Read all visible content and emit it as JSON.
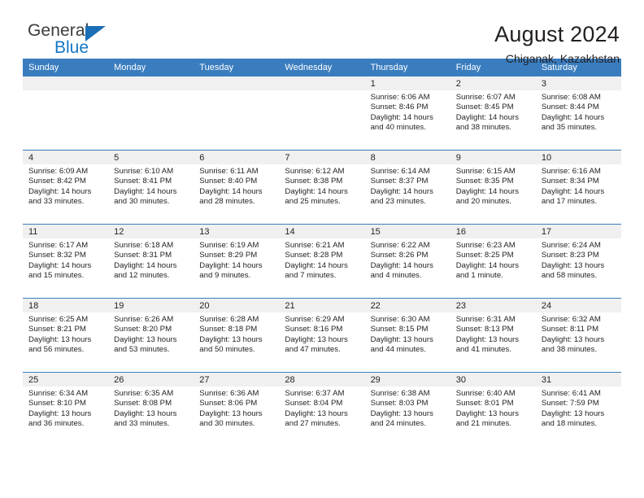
{
  "logo": {
    "word_one": "General",
    "word_two": "Blue",
    "triangle_color": "#1a6fb5"
  },
  "header": {
    "title": "August 2024",
    "subtitle": "Chiganak, Kazakhstan"
  },
  "theme": {
    "header_blue": "#3a7dbf",
    "daynum_gray": "#f0f0f0",
    "text": "#231f20"
  },
  "calendar": {
    "weekday_headers": [
      "Sunday",
      "Monday",
      "Tuesday",
      "Wednesday",
      "Thursday",
      "Friday",
      "Saturday"
    ],
    "labels": {
      "sunrise": "Sunrise:",
      "sunset": "Sunset:",
      "daylight": "Daylight:"
    },
    "weeks": [
      [
        {
          "day": ""
        },
        {
          "day": ""
        },
        {
          "day": ""
        },
        {
          "day": ""
        },
        {
          "day": "1",
          "sunrise": "Sunrise: 6:06 AM",
          "sunset": "Sunset: 8:46 PM",
          "daylight_1": "Daylight: 14 hours",
          "daylight_2": "and 40 minutes."
        },
        {
          "day": "2",
          "sunrise": "Sunrise: 6:07 AM",
          "sunset": "Sunset: 8:45 PM",
          "daylight_1": "Daylight: 14 hours",
          "daylight_2": "and 38 minutes."
        },
        {
          "day": "3",
          "sunrise": "Sunrise: 6:08 AM",
          "sunset": "Sunset: 8:44 PM",
          "daylight_1": "Daylight: 14 hours",
          "daylight_2": "and 35 minutes."
        }
      ],
      [
        {
          "day": "4",
          "sunrise": "Sunrise: 6:09 AM",
          "sunset": "Sunset: 8:42 PM",
          "daylight_1": "Daylight: 14 hours",
          "daylight_2": "and 33 minutes."
        },
        {
          "day": "5",
          "sunrise": "Sunrise: 6:10 AM",
          "sunset": "Sunset: 8:41 PM",
          "daylight_1": "Daylight: 14 hours",
          "daylight_2": "and 30 minutes."
        },
        {
          "day": "6",
          "sunrise": "Sunrise: 6:11 AM",
          "sunset": "Sunset: 8:40 PM",
          "daylight_1": "Daylight: 14 hours",
          "daylight_2": "and 28 minutes."
        },
        {
          "day": "7",
          "sunrise": "Sunrise: 6:12 AM",
          "sunset": "Sunset: 8:38 PM",
          "daylight_1": "Daylight: 14 hours",
          "daylight_2": "and 25 minutes."
        },
        {
          "day": "8",
          "sunrise": "Sunrise: 6:14 AM",
          "sunset": "Sunset: 8:37 PM",
          "daylight_1": "Daylight: 14 hours",
          "daylight_2": "and 23 minutes."
        },
        {
          "day": "9",
          "sunrise": "Sunrise: 6:15 AM",
          "sunset": "Sunset: 8:35 PM",
          "daylight_1": "Daylight: 14 hours",
          "daylight_2": "and 20 minutes."
        },
        {
          "day": "10",
          "sunrise": "Sunrise: 6:16 AM",
          "sunset": "Sunset: 8:34 PM",
          "daylight_1": "Daylight: 14 hours",
          "daylight_2": "and 17 minutes."
        }
      ],
      [
        {
          "day": "11",
          "sunrise": "Sunrise: 6:17 AM",
          "sunset": "Sunset: 8:32 PM",
          "daylight_1": "Daylight: 14 hours",
          "daylight_2": "and 15 minutes."
        },
        {
          "day": "12",
          "sunrise": "Sunrise: 6:18 AM",
          "sunset": "Sunset: 8:31 PM",
          "daylight_1": "Daylight: 14 hours",
          "daylight_2": "and 12 minutes."
        },
        {
          "day": "13",
          "sunrise": "Sunrise: 6:19 AM",
          "sunset": "Sunset: 8:29 PM",
          "daylight_1": "Daylight: 14 hours",
          "daylight_2": "and 9 minutes."
        },
        {
          "day": "14",
          "sunrise": "Sunrise: 6:21 AM",
          "sunset": "Sunset: 8:28 PM",
          "daylight_1": "Daylight: 14 hours",
          "daylight_2": "and 7 minutes."
        },
        {
          "day": "15",
          "sunrise": "Sunrise: 6:22 AM",
          "sunset": "Sunset: 8:26 PM",
          "daylight_1": "Daylight: 14 hours",
          "daylight_2": "and 4 minutes."
        },
        {
          "day": "16",
          "sunrise": "Sunrise: 6:23 AM",
          "sunset": "Sunset: 8:25 PM",
          "daylight_1": "Daylight: 14 hours",
          "daylight_2": "and 1 minute."
        },
        {
          "day": "17",
          "sunrise": "Sunrise: 6:24 AM",
          "sunset": "Sunset: 8:23 PM",
          "daylight_1": "Daylight: 13 hours",
          "daylight_2": "and 58 minutes."
        }
      ],
      [
        {
          "day": "18",
          "sunrise": "Sunrise: 6:25 AM",
          "sunset": "Sunset: 8:21 PM",
          "daylight_1": "Daylight: 13 hours",
          "daylight_2": "and 56 minutes."
        },
        {
          "day": "19",
          "sunrise": "Sunrise: 6:26 AM",
          "sunset": "Sunset: 8:20 PM",
          "daylight_1": "Daylight: 13 hours",
          "daylight_2": "and 53 minutes."
        },
        {
          "day": "20",
          "sunrise": "Sunrise: 6:28 AM",
          "sunset": "Sunset: 8:18 PM",
          "daylight_1": "Daylight: 13 hours",
          "daylight_2": "and 50 minutes."
        },
        {
          "day": "21",
          "sunrise": "Sunrise: 6:29 AM",
          "sunset": "Sunset: 8:16 PM",
          "daylight_1": "Daylight: 13 hours",
          "daylight_2": "and 47 minutes."
        },
        {
          "day": "22",
          "sunrise": "Sunrise: 6:30 AM",
          "sunset": "Sunset: 8:15 PM",
          "daylight_1": "Daylight: 13 hours",
          "daylight_2": "and 44 minutes."
        },
        {
          "day": "23",
          "sunrise": "Sunrise: 6:31 AM",
          "sunset": "Sunset: 8:13 PM",
          "daylight_1": "Daylight: 13 hours",
          "daylight_2": "and 41 minutes."
        },
        {
          "day": "24",
          "sunrise": "Sunrise: 6:32 AM",
          "sunset": "Sunset: 8:11 PM",
          "daylight_1": "Daylight: 13 hours",
          "daylight_2": "and 38 minutes."
        }
      ],
      [
        {
          "day": "25",
          "sunrise": "Sunrise: 6:34 AM",
          "sunset": "Sunset: 8:10 PM",
          "daylight_1": "Daylight: 13 hours",
          "daylight_2": "and 36 minutes."
        },
        {
          "day": "26",
          "sunrise": "Sunrise: 6:35 AM",
          "sunset": "Sunset: 8:08 PM",
          "daylight_1": "Daylight: 13 hours",
          "daylight_2": "and 33 minutes."
        },
        {
          "day": "27",
          "sunrise": "Sunrise: 6:36 AM",
          "sunset": "Sunset: 8:06 PM",
          "daylight_1": "Daylight: 13 hours",
          "daylight_2": "and 30 minutes."
        },
        {
          "day": "28",
          "sunrise": "Sunrise: 6:37 AM",
          "sunset": "Sunset: 8:04 PM",
          "daylight_1": "Daylight: 13 hours",
          "daylight_2": "and 27 minutes."
        },
        {
          "day": "29",
          "sunrise": "Sunrise: 6:38 AM",
          "sunset": "Sunset: 8:03 PM",
          "daylight_1": "Daylight: 13 hours",
          "daylight_2": "and 24 minutes."
        },
        {
          "day": "30",
          "sunrise": "Sunrise: 6:40 AM",
          "sunset": "Sunset: 8:01 PM",
          "daylight_1": "Daylight: 13 hours",
          "daylight_2": "and 21 minutes."
        },
        {
          "day": "31",
          "sunrise": "Sunrise: 6:41 AM",
          "sunset": "Sunset: 7:59 PM",
          "daylight_1": "Daylight: 13 hours",
          "daylight_2": "and 18 minutes."
        }
      ]
    ]
  }
}
